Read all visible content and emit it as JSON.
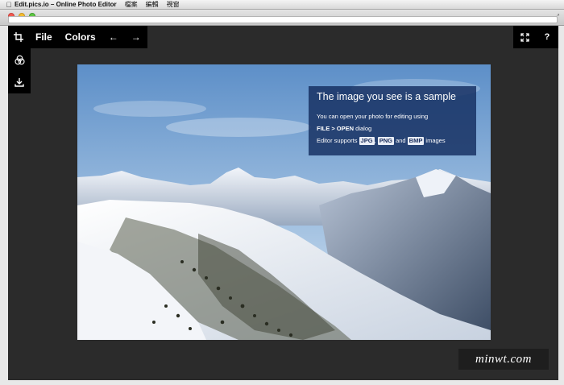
{
  "menubar": {
    "apple_icon": "apple-icon",
    "app_name": "Edit.pics.io – Online Photo Editor",
    "items": [
      "檔案",
      "編輯",
      "視窗"
    ]
  },
  "toolbar": {
    "crop_icon": "crop-icon",
    "file_label": "File",
    "colors_label": "Colors",
    "undo_glyph": "←",
    "redo_glyph": "→"
  },
  "sidebar": {
    "filters_icon": "filters-icon",
    "download_icon": "download-icon"
  },
  "topright": {
    "fullscreen_icon": "fullscreen-icon",
    "help_label": "?"
  },
  "sample": {
    "title": "The image you see is a sample",
    "line1": "You can open your photo for editing using",
    "line2_bold": "FILE > OPEN",
    "line2_rest": " dialog",
    "line3_pre": "Editor supports ",
    "fmt1": "JPG",
    "comma": ", ",
    "fmt2": "PNG",
    "and": " and ",
    "fmt3": "BMP",
    "line3_post": " images"
  },
  "watermark": "minwt.com",
  "colors": {
    "app_bg": "#2b2b2b",
    "toolbar_bg": "#000000",
    "overlay_bg": "rgba(20,45,95,0.82)"
  }
}
